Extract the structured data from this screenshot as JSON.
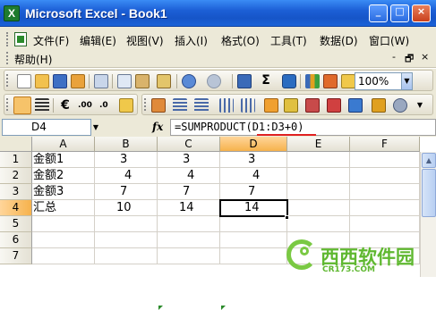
{
  "window": {
    "title": "Microsoft Excel - Book1",
    "app_icon": "excel-icon",
    "controls": [
      "_",
      "□",
      "×"
    ]
  },
  "menubar": {
    "items": [
      "文件(F)",
      "编辑(E)",
      "视图(V)",
      "插入(I)",
      "格式(O)",
      "工具(T)",
      "数据(D)",
      "窗口(W)",
      "帮助(H)"
    ],
    "doc_controls": [
      "-",
      "🗗",
      "×"
    ]
  },
  "toolbar": {
    "zoom": "100%",
    "icons_row1": [
      "new-icon",
      "open-icon",
      "save-icon",
      "permission-icon",
      "print-icon",
      "print-preview-icon",
      "copy-icon",
      "paste-icon",
      "format-painter-icon",
      "undo-icon",
      "redo-icon",
      "hyperlink-icon",
      "autosum-icon",
      "sort-icon",
      "chart-icon",
      "drawing-icon",
      "zoom-dropdown"
    ],
    "icons_row2": [
      "align-left-icon",
      "align-center-icon",
      "currency-icon",
      "percent-icon",
      "increase-decimal-icon",
      "decrease-decimal-icon",
      "indent-icon",
      "outdent-icon",
      "borders-icon",
      "fill-color-icon",
      "font-color-icon",
      "research-icon"
    ]
  },
  "formula_bar": {
    "name_box": "D4",
    "fx": "fx",
    "formula": "=SUMPRODUCT(D1:D3+0)"
  },
  "grid": {
    "columns": [
      "A",
      "B",
      "C",
      "D",
      "E",
      "F"
    ],
    "selected_column": "D",
    "rows": [
      {
        "num": "1",
        "cells": [
          "金额1",
          "3",
          "3",
          "3",
          "",
          ""
        ]
      },
      {
        "num": "2",
        "cells": [
          "金额2",
          "4",
          "4",
          "4",
          "",
          ""
        ]
      },
      {
        "num": "3",
        "cells": [
          "金额3",
          "7",
          "7",
          "7",
          "",
          ""
        ]
      },
      {
        "num": "4",
        "cells": [
          "汇总",
          "10",
          "14",
          "14",
          "",
          ""
        ]
      },
      {
        "num": "5",
        "cells": [
          "",
          "",
          "",
          "",
          "",
          ""
        ]
      },
      {
        "num": "6",
        "cells": [
          "",
          "",
          "",
          "",
          "",
          ""
        ]
      },
      {
        "num": "7",
        "cells": [
          "",
          "",
          "",
          "",
          "",
          ""
        ]
      }
    ],
    "active_cell": "D4"
  },
  "watermark": {
    "name": "西西软件园",
    "site": "CR173.COM"
  },
  "colors": {
    "titlebar": "#1c5fd6",
    "toolbar_bg": "#ece9d8",
    "selected_header": "#f6b24c",
    "error_triangle": "#2a8a2a",
    "watermark": "#5fb830",
    "underline": "#e02020"
  }
}
